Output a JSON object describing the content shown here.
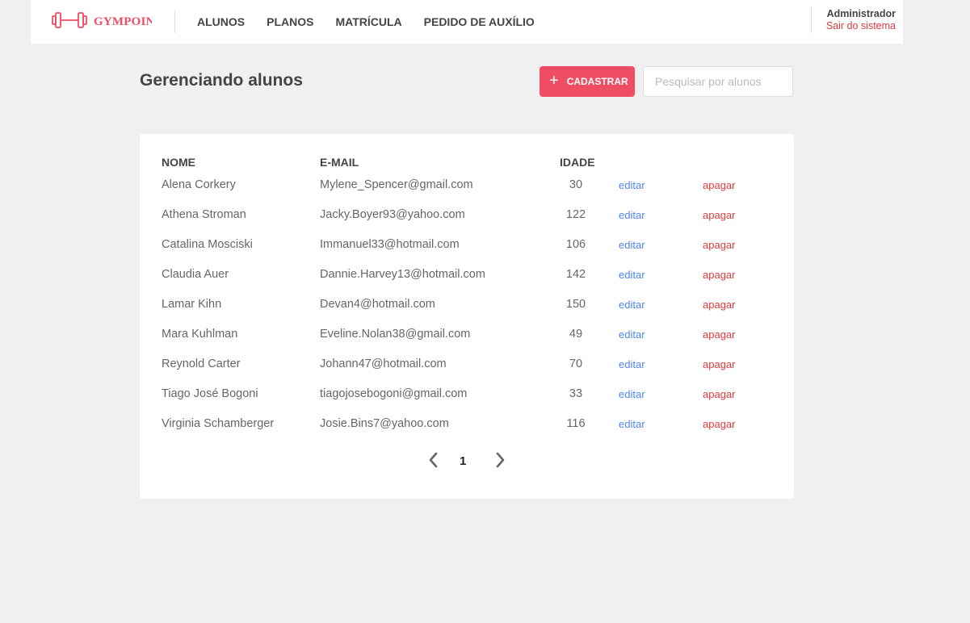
{
  "header": {
    "logo_text": "GYMPOINT",
    "nav": [
      "ALUNOS",
      "PLANOS",
      "MATRÍCULA",
      "PEDIDO DE AUXÍLIO"
    ],
    "user_name": "Administrador",
    "logout_label": "Sair do sistema"
  },
  "page": {
    "title": "Gerenciando alunos",
    "add_button_label": "CADASTRAR",
    "search_placeholder": "Pesquisar por alunos"
  },
  "table": {
    "columns": [
      "NOME",
      "E-MAIL",
      "IDADE"
    ],
    "edit_label": "editar",
    "delete_label": "apagar",
    "rows": [
      {
        "name": "Alena Corkery",
        "email": "Mylene_Spencer@gmail.com",
        "age": "30"
      },
      {
        "name": "Athena Stroman",
        "email": "Jacky.Boyer93@yahoo.com",
        "age": "122"
      },
      {
        "name": "Catalina Mosciski",
        "email": "Immanuel33@hotmail.com",
        "age": "106"
      },
      {
        "name": "Claudia Auer",
        "email": "Dannie.Harvey13@hotmail.com",
        "age": "142"
      },
      {
        "name": "Lamar Kihn",
        "email": "Devan4@hotmail.com",
        "age": "150"
      },
      {
        "name": "Mara Kuhlman",
        "email": "Eveline.Nolan38@gmail.com",
        "age": "49"
      },
      {
        "name": "Reynold Carter",
        "email": "Johann47@hotmail.com",
        "age": "70"
      },
      {
        "name": "Tiago José Bogoni",
        "email": "tiagojosebogoni@gmail.com",
        "age": "33"
      },
      {
        "name": "Virginia Schamberger",
        "email": "Josie.Bins7@yahoo.com",
        "age": "116"
      }
    ]
  },
  "pagination": {
    "current_page": "1"
  },
  "colors": {
    "accent": "#ee4d64",
    "edit": "#4d85ee",
    "delete": "#de3b3b",
    "background": "#f0f0f0"
  },
  "icons": [
    "dumbbell-logo-icon",
    "plus-icon",
    "chevron-left-icon",
    "chevron-right-icon"
  ]
}
